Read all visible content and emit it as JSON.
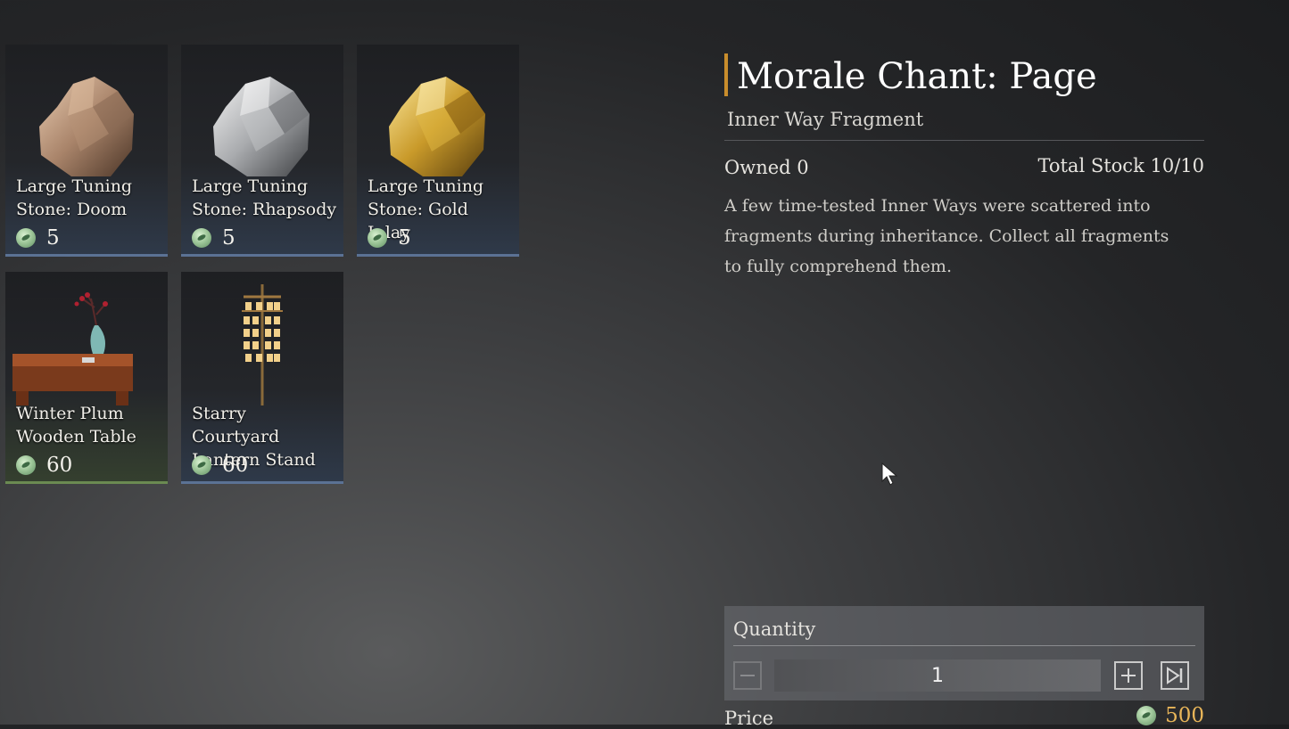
{
  "items": [
    {
      "name": "Large Tuning Stone: Doom",
      "price": "5",
      "icon": "copper-stone-icon"
    },
    {
      "name": "Large Tuning Stone: Rhapsody",
      "price": "5",
      "icon": "silver-stone-icon"
    },
    {
      "name": "Large Tuning Stone: Gold Inlay",
      "price": "5",
      "icon": "gold-stone-icon"
    },
    {
      "name": "Winter Plum Wooden Table",
      "price": "60",
      "icon": "wooden-table-icon"
    },
    {
      "name": "Starry Courtyard Lantern Stand",
      "price": "60",
      "icon": "lantern-stand-icon"
    }
  ],
  "detail": {
    "title": "Morale Chant: Page",
    "subtitle": "Inner Way Fragment",
    "owned": "Owned 0",
    "stock": "Total Stock 10/10",
    "description": "A few time-tested Inner Ways were scattered into fragments during inheritance. Collect all fragments to fully comprehend them."
  },
  "purchase": {
    "quantity_label": "Quantity",
    "quantity": "1",
    "price_label": "Price",
    "price": "500"
  },
  "colors": {
    "accent": "#c98d2c",
    "price_gold": "#e9b659",
    "rarity_blue": "#5b7294",
    "rarity_green": "#6b8a52"
  },
  "icons": [
    "jade-coin-icon",
    "minus-icon",
    "plus-icon",
    "max-icon",
    "mouse-cursor-icon"
  ]
}
